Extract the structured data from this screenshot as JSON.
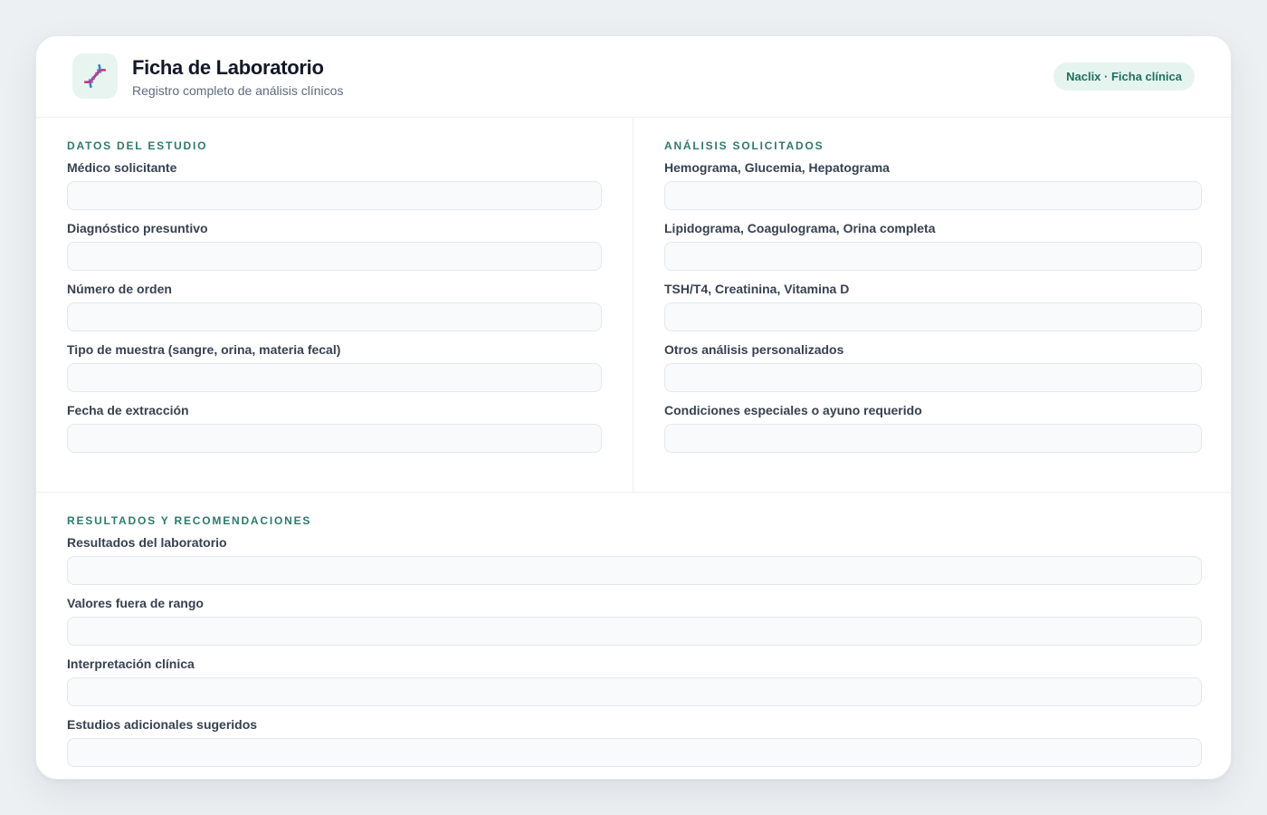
{
  "header": {
    "title": "Ficha de Laboratorio",
    "subtitle": "Registro completo de análisis clínicos",
    "badge": "Naclix · Ficha clínica",
    "logo_icon": "dna-icon"
  },
  "sections": {
    "study": {
      "title": "DATOS DEL ESTUDIO",
      "fields": [
        {
          "label": "Médico solicitante",
          "value": ""
        },
        {
          "label": "Diagnóstico presuntivo",
          "value": ""
        },
        {
          "label": "Número de orden",
          "value": ""
        },
        {
          "label": "Tipo de muestra (sangre, orina, materia fecal)",
          "value": ""
        },
        {
          "label": "Fecha de extracción",
          "value": ""
        }
      ]
    },
    "analyses": {
      "title": "ANÁLISIS SOLICITADOS",
      "fields": [
        {
          "label": "Hemograma, Glucemia, Hepatograma",
          "value": ""
        },
        {
          "label": "Lipidograma, Coagulograma, Orina completa",
          "value": ""
        },
        {
          "label": "TSH/T4, Creatinina, Vitamina D",
          "value": ""
        },
        {
          "label": "Otros análisis personalizados",
          "value": ""
        },
        {
          "label": "Condiciones especiales o ayuno requerido",
          "value": ""
        }
      ]
    },
    "results": {
      "title": "RESULTADOS Y RECOMENDACIONES",
      "fields": [
        {
          "label": "Resultados del laboratorio",
          "value": ""
        },
        {
          "label": "Valores fuera de rango",
          "value": ""
        },
        {
          "label": "Interpretación clínica",
          "value": ""
        },
        {
          "label": "Estudios adicionales sugeridos",
          "value": ""
        }
      ]
    }
  },
  "colors": {
    "accent": "#2d7a6a",
    "badge_bg": "#e6f4ef",
    "page_bg": "#edf0f3",
    "dna_strand_a": "#2b87c9",
    "dna_strand_b": "#c2357e"
  }
}
